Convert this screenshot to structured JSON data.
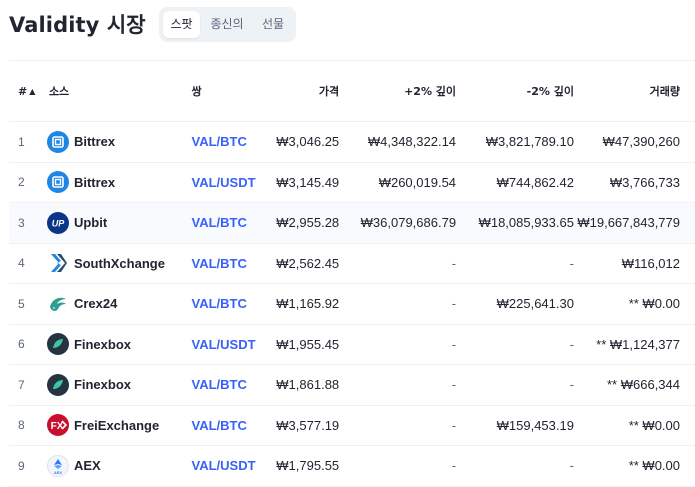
{
  "page": {
    "title": "Validity 시장"
  },
  "tabs": [
    {
      "label": "스팟",
      "active": true
    },
    {
      "label": "종신의",
      "active": false
    },
    {
      "label": "선물",
      "active": false
    }
  ],
  "table": {
    "headers": {
      "rank": "#",
      "source": "소스",
      "pair": "쌍",
      "price": "가격",
      "depth_plus2": "+2% 깊이",
      "depth_minus2": "-2% 깊이",
      "volume": "거래량"
    },
    "rows": [
      {
        "rank": "1",
        "exchange": "Bittrex",
        "logo": "bittrex-icon",
        "pair": "VAL/BTC",
        "price": "₩3,046.25",
        "depth_plus2": "₩4,348,322.14",
        "depth_minus2": "₩3,821,789.10",
        "volume": "₩47,390,260"
      },
      {
        "rank": "2",
        "exchange": "Bittrex",
        "logo": "bittrex-icon",
        "pair": "VAL/USDT",
        "price": "₩3,145.49",
        "depth_plus2": "₩260,019.54",
        "depth_minus2": "₩744,862.42",
        "volume": "₩3,766,733"
      },
      {
        "rank": "3",
        "exchange": "Upbit",
        "logo": "upbit-icon",
        "pair": "VAL/BTC",
        "price": "₩2,955.28",
        "depth_plus2": "₩36,079,686.79",
        "depth_minus2": "₩18,085,933.65",
        "volume": "₩19,667,843,779"
      },
      {
        "rank": "4",
        "exchange": "SouthXchange",
        "logo": "southxchange-icon",
        "pair": "VAL/BTC",
        "price": "₩2,562.45",
        "depth_plus2": "-",
        "depth_minus2": "-",
        "volume": "₩116,012"
      },
      {
        "rank": "5",
        "exchange": "Crex24",
        "logo": "crex24-icon",
        "pair": "VAL/BTC",
        "price": "₩1,165.92",
        "depth_plus2": "-",
        "depth_minus2": "₩225,641.30",
        "volume": "** ₩0.00"
      },
      {
        "rank": "6",
        "exchange": "Finexbox",
        "logo": "finexbox-icon",
        "pair": "VAL/USDT",
        "price": "₩1,955.45",
        "depth_plus2": "-",
        "depth_minus2": "-",
        "volume": "** ₩1,124,377"
      },
      {
        "rank": "7",
        "exchange": "Finexbox",
        "logo": "finexbox-icon",
        "pair": "VAL/BTC",
        "price": "₩1,861.88",
        "depth_plus2": "-",
        "depth_minus2": "-",
        "volume": "** ₩666,344"
      },
      {
        "rank": "8",
        "exchange": "FreiExchange",
        "logo": "freiexchange-icon",
        "pair": "VAL/BTC",
        "price": "₩3,577.19",
        "depth_plus2": "-",
        "depth_minus2": "₩159,453.19",
        "volume": "** ₩0.00"
      },
      {
        "rank": "9",
        "exchange": "AEX",
        "logo": "aex-icon",
        "pair": "VAL/USDT",
        "price": "₩1,795.55",
        "depth_plus2": "-",
        "depth_minus2": "-",
        "volume": "** ₩0.00"
      }
    ]
  },
  "colors": {
    "pair_link": "#3861fb",
    "muted": "#58667e",
    "highlight_row": "#f8fafd"
  }
}
